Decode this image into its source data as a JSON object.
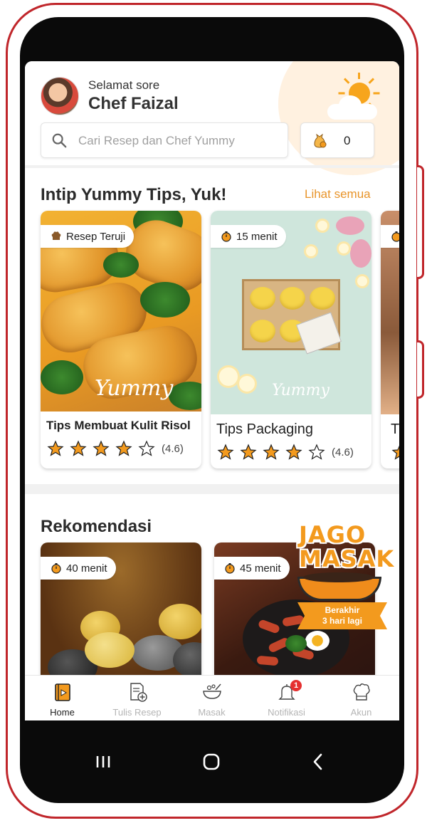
{
  "header": {
    "greeting": "Selamat sore",
    "user_name": "Chef Faizal",
    "search_placeholder": "Cari Resep dan Chef Yummy",
    "coin_count": "0"
  },
  "tips": {
    "title": "Intip Yummy Tips, Yuk!",
    "see_all": "Lihat semua",
    "cards": [
      {
        "badge": "Resep Teruji",
        "title": "Tips Membuat Kulit Risol",
        "rating": "(4.6)",
        "stars_filled": 4
      },
      {
        "badge": "15 menit",
        "title": "Tips Packaging",
        "rating": "(4.6)",
        "stars_filled": 4
      },
      {
        "badge": "",
        "title": "T",
        "rating": "",
        "stars_filled": 1
      }
    ],
    "watermark": "Yummy"
  },
  "recommendations": {
    "title": "Rekomendasi",
    "cards": [
      {
        "badge": "40 menit"
      },
      {
        "badge": "45 menit"
      }
    ],
    "promo": {
      "line1": "JAGO",
      "line2": "MASAK",
      "ribbon_line1": "Berakhir",
      "ribbon_line2": "3 hari lagi"
    }
  },
  "bottom_nav": [
    {
      "label": "Home",
      "icon": "home-book-icon",
      "active": true
    },
    {
      "label": "Tulis Resep",
      "icon": "write-recipe-icon",
      "active": false
    },
    {
      "label": "Masak",
      "icon": "cooking-pot-icon",
      "active": false
    },
    {
      "label": "Notifikasi",
      "icon": "bell-icon",
      "active": false,
      "badge": "1"
    },
    {
      "label": "Akun",
      "icon": "chef-hat-icon",
      "active": false
    }
  ],
  "colors": {
    "accent": "#e8942a",
    "star": "#f39a1e",
    "frame": "#c0262b",
    "badge_red": "#e53030"
  }
}
